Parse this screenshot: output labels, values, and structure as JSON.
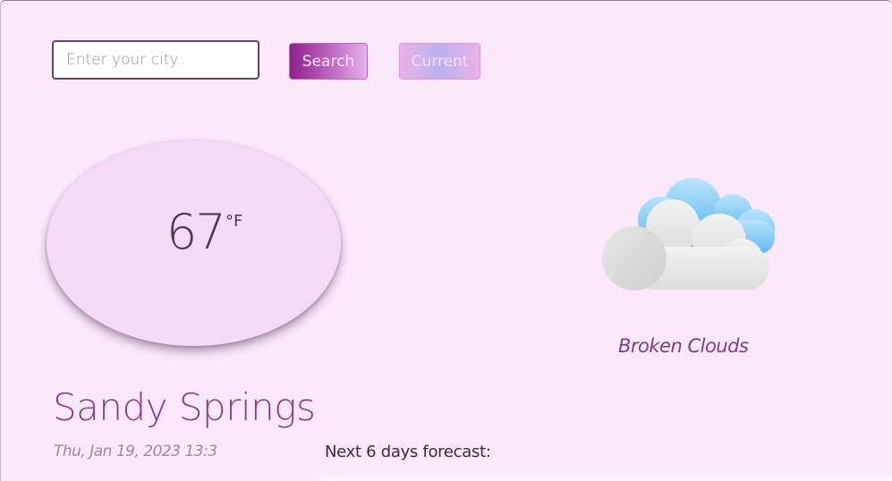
{
  "search": {
    "placeholder": "Enter your city..",
    "button_label": "Search",
    "current_label": "Current"
  },
  "weather": {
    "temperature": "67",
    "unit": "°F",
    "description": "Broken Clouds",
    "icon": "broken-clouds-icon"
  },
  "location": {
    "city": "Sandy Springs",
    "datetime": "Thu, Jan 19, 2023 13:3"
  },
  "forecast": {
    "title": "Next 6 days forecast:"
  }
}
